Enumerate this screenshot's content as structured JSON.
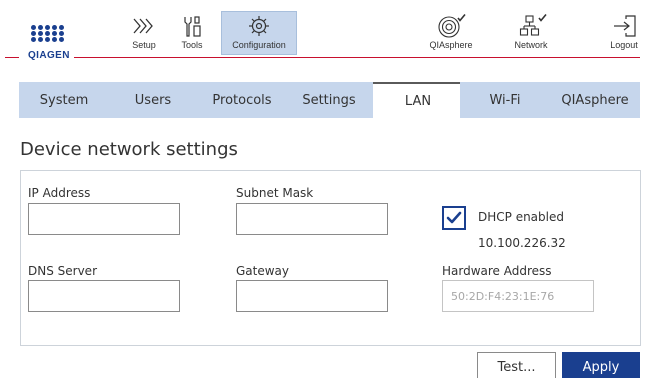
{
  "brand": {
    "name": "QIAGEN"
  },
  "nav": {
    "setup": {
      "label": "Setup",
      "icon": "chevrons-right-icon"
    },
    "tools": {
      "label": "Tools",
      "icon": "tools-icon"
    },
    "configuration": {
      "label": "Configuration",
      "icon": "gear-icon",
      "active": true
    },
    "qiasphere": {
      "label": "QIAsphere",
      "icon": "qiasphere-connected-icon"
    },
    "network": {
      "label": "Network",
      "icon": "network-connected-icon"
    },
    "logout": {
      "label": "Logout",
      "icon": "logout-icon"
    }
  },
  "tabs": [
    {
      "label": "System"
    },
    {
      "label": "Users"
    },
    {
      "label": "Protocols"
    },
    {
      "label": "Settings"
    },
    {
      "label": "LAN",
      "active": true
    },
    {
      "label": "Wi-Fi"
    },
    {
      "label": "QIAsphere"
    }
  ],
  "page": {
    "title": "Device network settings"
  },
  "form": {
    "ip_address": {
      "label": "IP Address",
      "value": ""
    },
    "subnet_mask": {
      "label": "Subnet Mask",
      "value": ""
    },
    "dns_server": {
      "label": "DNS Server",
      "value": ""
    },
    "gateway": {
      "label": "Gateway",
      "value": ""
    },
    "dhcp": {
      "label": "DHCP enabled",
      "checked": true,
      "address": "10.100.226.32"
    },
    "hardware_address": {
      "label": "Hardware Address",
      "value": "50:2D:F4:23:1E:76"
    }
  },
  "buttons": {
    "test": "Test...",
    "apply": "Apply"
  },
  "colors": {
    "brand_blue": "#1a3f8f",
    "accent_red": "#c8102e",
    "tab_bg": "#c6d6ec"
  }
}
